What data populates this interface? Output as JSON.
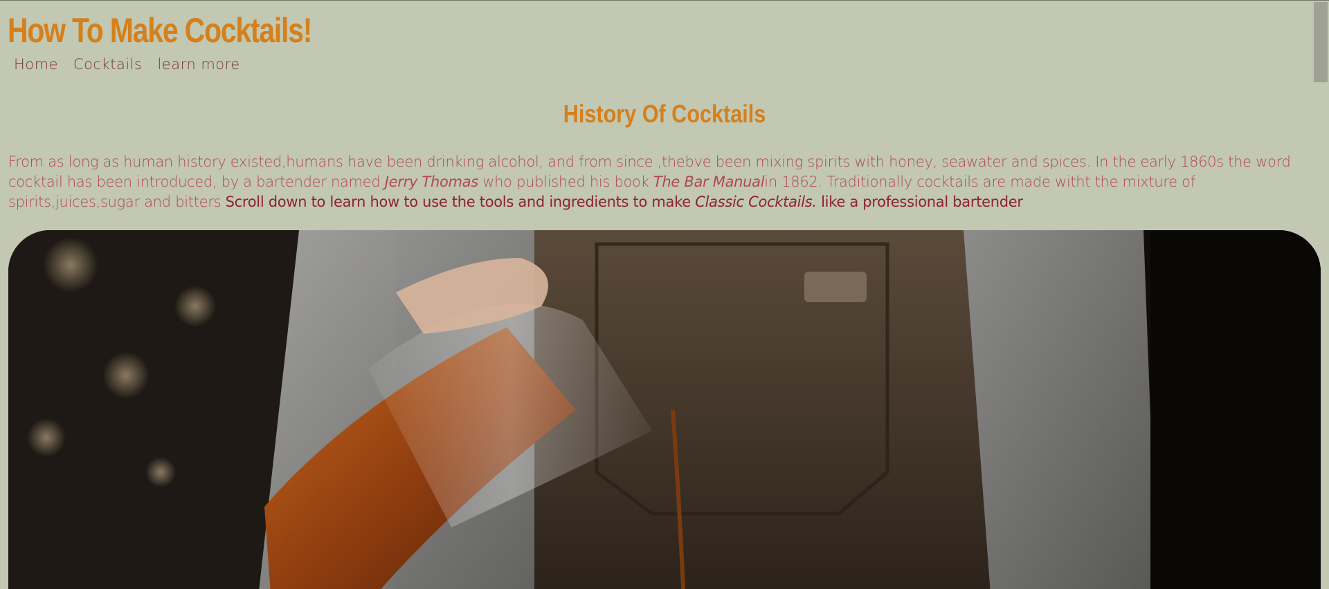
{
  "site": {
    "title": "How To Make Cocktails!"
  },
  "nav": {
    "items": [
      {
        "label": "Home"
      },
      {
        "label": "Cocktails"
      },
      {
        "label": "learn more"
      }
    ]
  },
  "history": {
    "heading": "History Of Cocktails",
    "text_1": "From as long as human history existed,humans have been drinking alcohol, and from since ,thebve been mixing spirits with honey, seawater and spices. In the early 1860s the word cocktail has been introduced, by a bartender named ",
    "name_italic": "Jerry Thomas",
    "text_2": " who published his book ",
    "book_italic": "The Bar Manual",
    "text_3": "in 1862. Traditionally cocktails are made witht the mixture of spirits,juices,sugar and bitters ",
    "callout_1": "Scroll down to learn how to use the tools and ingredients to make ",
    "callout_italic": "Classic Cocktails.",
    "callout_2": " like a professional bartender"
  },
  "hero": {
    "alt": "bartender pouring a cocktail"
  },
  "colors": {
    "background": "#c2c8b2",
    "accent": "#d5801c",
    "nav_text": "#7b3a35",
    "body_text": "#b34752",
    "callout_text": "#8e2231"
  }
}
